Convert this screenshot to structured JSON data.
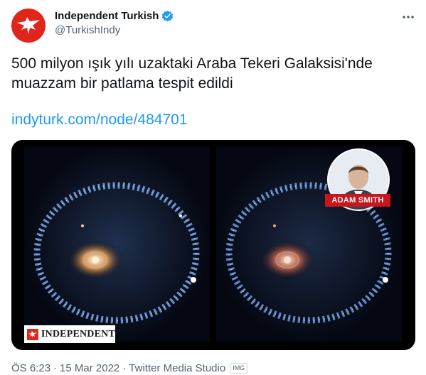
{
  "account": {
    "display_name": "Independent Turkish",
    "handle": "@TurkishIndy"
  },
  "tweet": {
    "text": "500 milyon ışık yılı uzaktaki Araba Tekeri Galaksisi'nde\nmuazzam bir patlama tespit edildi",
    "link": "indyturk.com/node/484701"
  },
  "media": {
    "reporter_label": "ADAM SMITH",
    "logo_label": "INDEPENDENT"
  },
  "meta": {
    "time": "ÖS 6:23",
    "sep1": "·",
    "date": "15 Mar 2022",
    "sep2": "·",
    "source": "Twitter Media Studio",
    "badge": "IMG"
  },
  "colors": {
    "brand_red": "#e0251b",
    "link_blue": "#1d9bf0",
    "verified_blue": "#1d9bf0",
    "muted": "#536471"
  },
  "icons": {
    "verified": "verified-badge-icon",
    "more": "more-dots-icon",
    "eagle": "eagle-logo-icon"
  }
}
